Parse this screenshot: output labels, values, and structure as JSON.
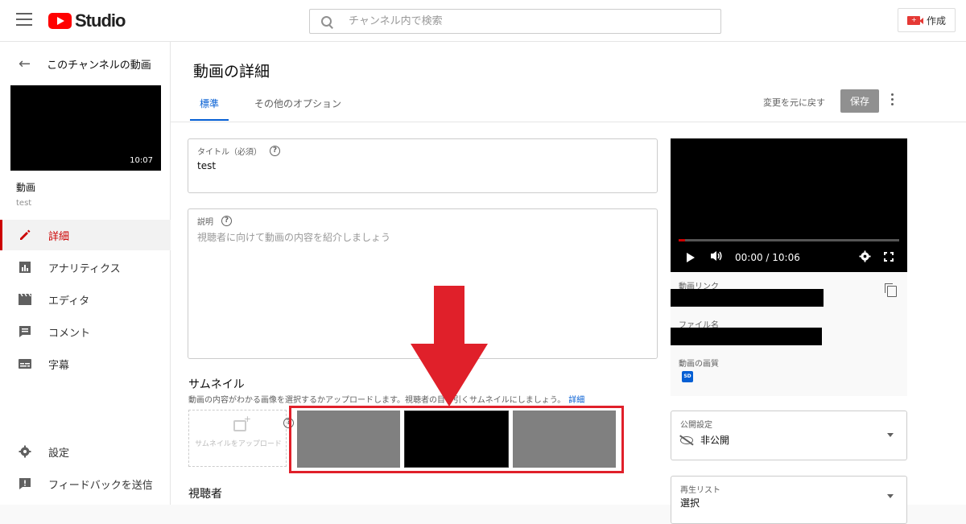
{
  "header": {
    "logo_text": "Studio",
    "search_placeholder": "チャンネル内で検索",
    "create_label": "作成"
  },
  "sidebar": {
    "back_label": "このチャンネルの動画",
    "thumb_duration": "10:07",
    "video_title": "動画",
    "video_subtitle": "test",
    "items": [
      {
        "label": "詳細",
        "icon": "pencil-icon",
        "active": true
      },
      {
        "label": "アナリティクス",
        "icon": "analytics-icon",
        "active": false
      },
      {
        "label": "エディタ",
        "icon": "editor-icon",
        "active": false
      },
      {
        "label": "コメント",
        "icon": "comment-icon",
        "active": false
      },
      {
        "label": "字幕",
        "icon": "subtitles-icon",
        "active": false
      }
    ],
    "bottom_items": [
      {
        "label": "設定",
        "icon": "gear-icon"
      },
      {
        "label": "フィードバックを送信",
        "icon": "feedback-icon"
      }
    ]
  },
  "main": {
    "page_title": "動画の詳細",
    "tabs": [
      {
        "label": "標準",
        "active": true
      },
      {
        "label": "その他のオプション",
        "active": false
      }
    ],
    "undo_label": "変更を元に戻す",
    "save_label": "保存",
    "title_field": {
      "label": "タイトル（必須）",
      "value": "test"
    },
    "description_field": {
      "label": "説明",
      "placeholder": "視聴者に向けて動画の内容を紹介しましょう"
    },
    "thumbnail": {
      "heading": "サムネイル",
      "description": "動画の内容がわかる画像を選択するかアップロードします。視聴者の目を引くサムネイルにしましょう。",
      "details_link": "詳細",
      "upload_label": "サムネイルをアップロード",
      "options": [
        {
          "color": "#808080",
          "selected": false
        },
        {
          "color": "#000000",
          "selected": true
        },
        {
          "color": "#808080",
          "selected": false
        }
      ]
    },
    "audience_heading": "視聴者"
  },
  "preview": {
    "time": "00:00 / 10:06",
    "progress": 0.03,
    "video_link_label": "動画リンク",
    "filename_label": "ファイル名",
    "quality_label": "動画の画質",
    "quality_badge": "SD"
  },
  "visibility": {
    "label": "公開設定",
    "value": "非公開"
  },
  "playlist": {
    "label": "再生リスト",
    "value": "選択"
  },
  "colors": {
    "accent_red": "#cc0000",
    "link_blue": "#065fd4",
    "annotation_red": "#e0202a"
  }
}
